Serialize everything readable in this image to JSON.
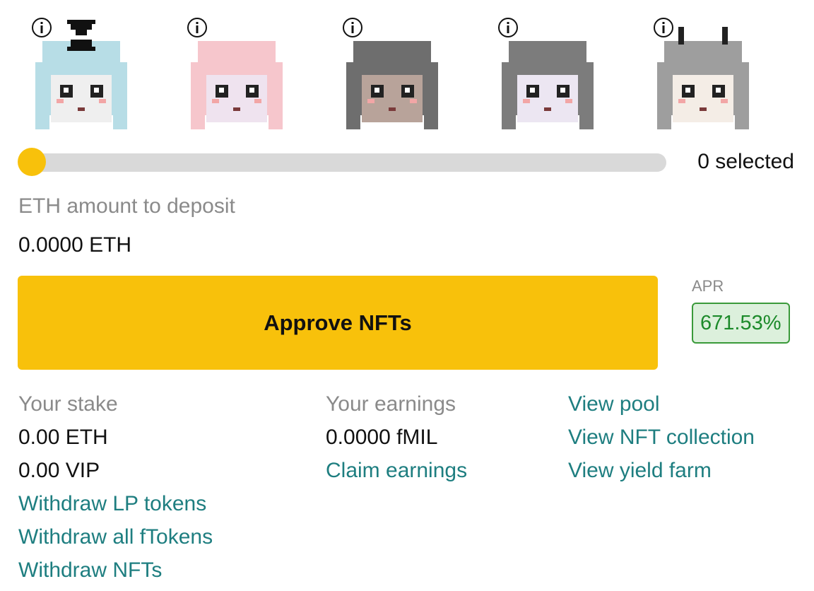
{
  "nfts": [
    {
      "name": "nft-1",
      "hair": "#b7dde6",
      "face": "#efefef",
      "extra": "hourglass"
    },
    {
      "name": "nft-2",
      "hair": "#f6c6cc",
      "face": "#efe3ef",
      "extra": "none"
    },
    {
      "name": "nft-3",
      "hair": "#6e6e6e",
      "face": "#b8a39a",
      "extra": "none"
    },
    {
      "name": "nft-4",
      "hair": "#7c7c7c",
      "face": "#ece6f2",
      "extra": "none"
    },
    {
      "name": "nft-5",
      "hair": "#9e9e9e",
      "face": "#f4ede6",
      "extra": "horns"
    }
  ],
  "icons": {
    "info": "info-icon"
  },
  "slider": {
    "value": 0,
    "selected_label": "0 selected"
  },
  "deposit": {
    "label": "ETH amount to deposit",
    "value": "0.0000 ETH"
  },
  "approve": {
    "label": "Approve NFTs"
  },
  "apr": {
    "label": "APR",
    "value": "671.53%"
  },
  "stake": {
    "label": "Your stake",
    "eth": "0.00 ETH",
    "vip": "0.00 VIP",
    "withdraw_lp": "Withdraw LP tokens",
    "withdraw_ftokens": "Withdraw all fTokens",
    "withdraw_nfts": "Withdraw NFTs"
  },
  "earnings": {
    "label": "Your earnings",
    "value": "0.0000 fMIL",
    "claim": "Claim earnings"
  },
  "links": {
    "pool": "View pool",
    "collection": "View NFT collection",
    "farm": "View yield farm"
  },
  "colors": {
    "accent_yellow": "#f8c10b",
    "link_teal": "#1e7e80",
    "muted_gray": "#8a8a8a",
    "apr_green": "#1c8a2a",
    "apr_bg": "#dcf0dc",
    "track": "#d9d9d9"
  }
}
